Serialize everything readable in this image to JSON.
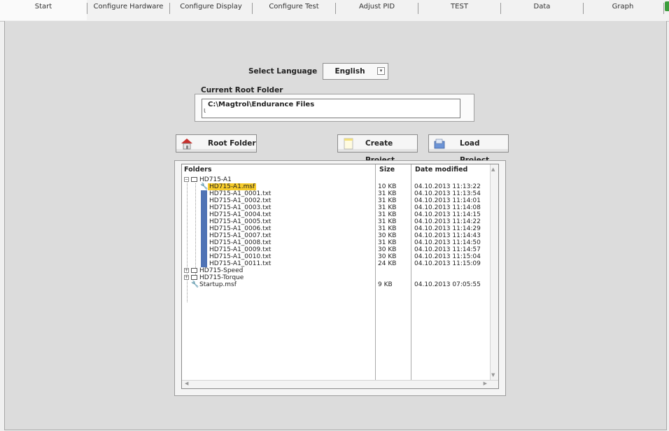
{
  "tabs": [
    {
      "label": "Start",
      "active": true
    },
    {
      "label": "Configure Hardware",
      "active": false
    },
    {
      "label": "Configure Display",
      "active": false
    },
    {
      "label": "Configure Test",
      "active": false
    },
    {
      "label": "Adjust PID",
      "active": false
    },
    {
      "label": "TEST",
      "active": false
    },
    {
      "label": "Data",
      "active": false
    },
    {
      "label": "Graph",
      "active": false
    }
  ],
  "language": {
    "label": "Select Language",
    "value": "English"
  },
  "root_folder": {
    "label": "Current Root Folder",
    "value": "C:\\Magtrol\\Endurance Files"
  },
  "buttons": {
    "root_folder": "Root Folder",
    "create_project": "Create Project",
    "load_project": "Load Project"
  },
  "explorer": {
    "columns": {
      "folders": "Folders",
      "size": "Size",
      "date": "Date modified"
    },
    "rows": [
      {
        "name": "HD715-A1",
        "type": "folder",
        "expanded": true,
        "size": "",
        "date": ""
      },
      {
        "name": "HD715-A1.msf",
        "type": "msf",
        "selected": true,
        "size": "10 KB",
        "date": "04.10.2013 11:13:22"
      },
      {
        "name": "HD715-A1_0001.txt",
        "type": "txt",
        "size": "31 KB",
        "date": "04.10.2013 11:13:54"
      },
      {
        "name": "HD715-A1_0002.txt",
        "type": "txt",
        "size": "31 KB",
        "date": "04.10.2013 11:14:01"
      },
      {
        "name": "HD715-A1_0003.txt",
        "type": "txt",
        "size": "31 KB",
        "date": "04.10.2013 11:14:08"
      },
      {
        "name": "HD715-A1_0004.txt",
        "type": "txt",
        "size": "31 KB",
        "date": "04.10.2013 11:14:15"
      },
      {
        "name": "HD715-A1_0005.txt",
        "type": "txt",
        "size": "31 KB",
        "date": "04.10.2013 11:14:22"
      },
      {
        "name": "HD715-A1_0006.txt",
        "type": "txt",
        "size": "31 KB",
        "date": "04.10.2013 11:14:29"
      },
      {
        "name": "HD715-A1_0007.txt",
        "type": "txt",
        "size": "30 KB",
        "date": "04.10.2013 11:14:43"
      },
      {
        "name": "HD715-A1_0008.txt",
        "type": "txt",
        "size": "31 KB",
        "date": "04.10.2013 11:14:50"
      },
      {
        "name": "HD715-A1_0009.txt",
        "type": "txt",
        "size": "30 KB",
        "date": "04.10.2013 11:14:57"
      },
      {
        "name": "HD715-A1_0010.txt",
        "type": "txt",
        "size": "30 KB",
        "date": "04.10.2013 11:15:04"
      },
      {
        "name": "HD715-A1_0011.txt",
        "type": "txt",
        "size": "24 KB",
        "date": "04.10.2013 11:15:09"
      },
      {
        "name": "HD715-Speed",
        "type": "folder",
        "expanded": false,
        "size": "",
        "date": ""
      },
      {
        "name": "HD715-Torque",
        "type": "folder",
        "expanded": false,
        "size": "",
        "date": ""
      },
      {
        "name": "Startup.msf",
        "type": "msf",
        "size": "9 KB",
        "date": "04.10.2013 07:05:55"
      }
    ]
  },
  "colors": {
    "selection": "#f7cc2b",
    "txt_icon": "#4f73b5",
    "background": "#dcdcdc"
  },
  "icons": {
    "root_folder": "home-icon",
    "create_project": "new-document-icon",
    "load_project": "open-folder-icon"
  }
}
